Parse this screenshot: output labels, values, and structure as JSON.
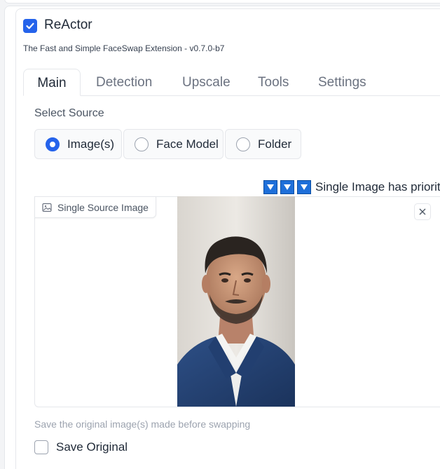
{
  "extension": {
    "title": "ReActor",
    "subtitle": "The Fast and Simple FaceSwap Extension - v0.7.0-b7",
    "enabled": true
  },
  "tabs": [
    {
      "label": "Main",
      "active": true
    },
    {
      "label": "Detection",
      "active": false
    },
    {
      "label": "Upscale",
      "active": false
    },
    {
      "label": "Tools",
      "active": false
    },
    {
      "label": "Settings",
      "active": false
    }
  ],
  "source": {
    "label": "Select Source",
    "options": [
      {
        "label": "Image(s)",
        "selected": true
      },
      {
        "label": "Face Model",
        "selected": false
      },
      {
        "label": "Folder",
        "selected": false
      }
    ]
  },
  "priority_note": "Single Image has priority",
  "image_panel": {
    "label": "Single Source Image",
    "icon": "image-icon",
    "close_icon": "close-icon"
  },
  "save_original": {
    "description": "Save the original image(s) made before swapping",
    "label": "Save Original",
    "checked": false
  },
  "colors": {
    "accent": "#2563eb",
    "dropdown_icon": "#1e6fd9"
  }
}
